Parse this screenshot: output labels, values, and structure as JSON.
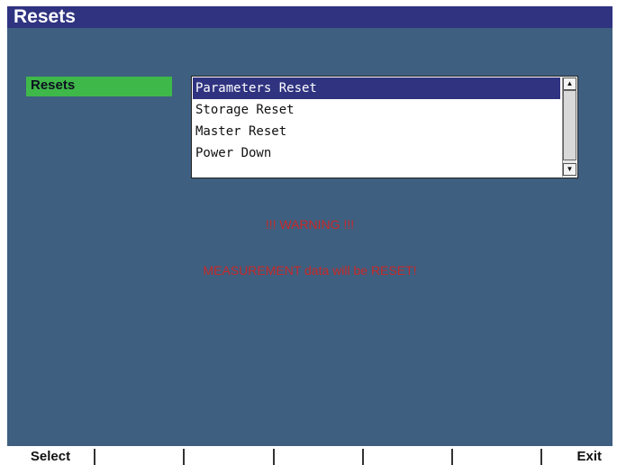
{
  "window": {
    "title": "Resets"
  },
  "section": {
    "label": "Resets"
  },
  "list": {
    "items": [
      "Parameters Reset",
      "Storage Reset",
      "Master Reset",
      "Power Down"
    ],
    "selected_index": 0,
    "scroll_up_glyph": "▲",
    "scroll_down_glyph": "▼"
  },
  "warning": {
    "title": "!!! WARNING !!!",
    "message": "MEASUREMENT data will be RESET!",
    "color": "#c62828"
  },
  "softkeys": [
    "Select",
    "",
    "",
    "",
    "",
    "",
    "Exit"
  ],
  "colors": {
    "background": "#3e5f7f",
    "titlebar": "#2f3380",
    "section_label": "#3fb84a",
    "selection": "#2f3380"
  }
}
